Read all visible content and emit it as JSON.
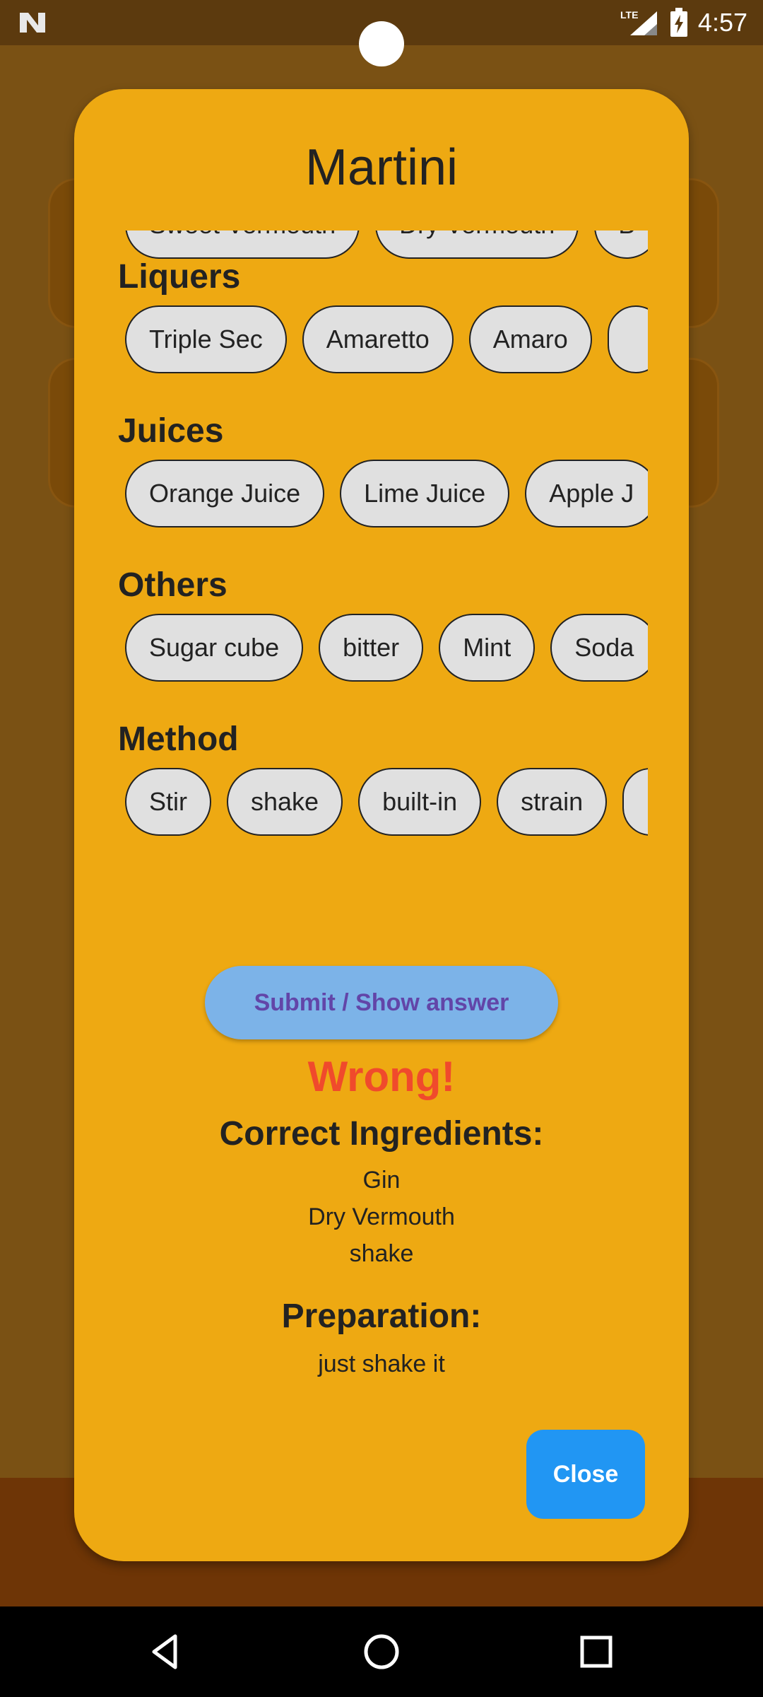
{
  "status_bar": {
    "time": "4:57",
    "network": "LTE"
  },
  "dialog": {
    "title": "Martini",
    "sections": [
      {
        "header": "",
        "chips": [
          "Sweet Vermouth",
          "Dry Vermouth",
          "B"
        ]
      },
      {
        "header": "Liquers",
        "chips": [
          "Triple Sec",
          "Amaretto",
          "Amaro",
          ""
        ]
      },
      {
        "header": "Juices",
        "chips": [
          "Orange Juice",
          "Lime Juice",
          "Apple J"
        ]
      },
      {
        "header": "Others",
        "chips": [
          "Sugar cube",
          "bitter",
          "Mint",
          "Soda"
        ]
      },
      {
        "header": "Method",
        "chips": [
          "Stir",
          "shake",
          "built-in",
          "strain",
          ""
        ]
      }
    ],
    "submit_label": "Submit / Show answer",
    "result": "Wrong!",
    "correct_heading": "Correct Ingredients:",
    "correct_items": [
      "Gin",
      "Dry Vermouth",
      "shake"
    ],
    "prep_heading": "Preparation:",
    "prep_text": "just shake it",
    "close_label": "Close"
  },
  "colors": {
    "dialog_bg": "#eea912",
    "chip_bg": "#e0e0e0",
    "wrong": "#f04a2c",
    "submit_bg": "#7cb3e8",
    "close_bg": "#2196f3"
  }
}
